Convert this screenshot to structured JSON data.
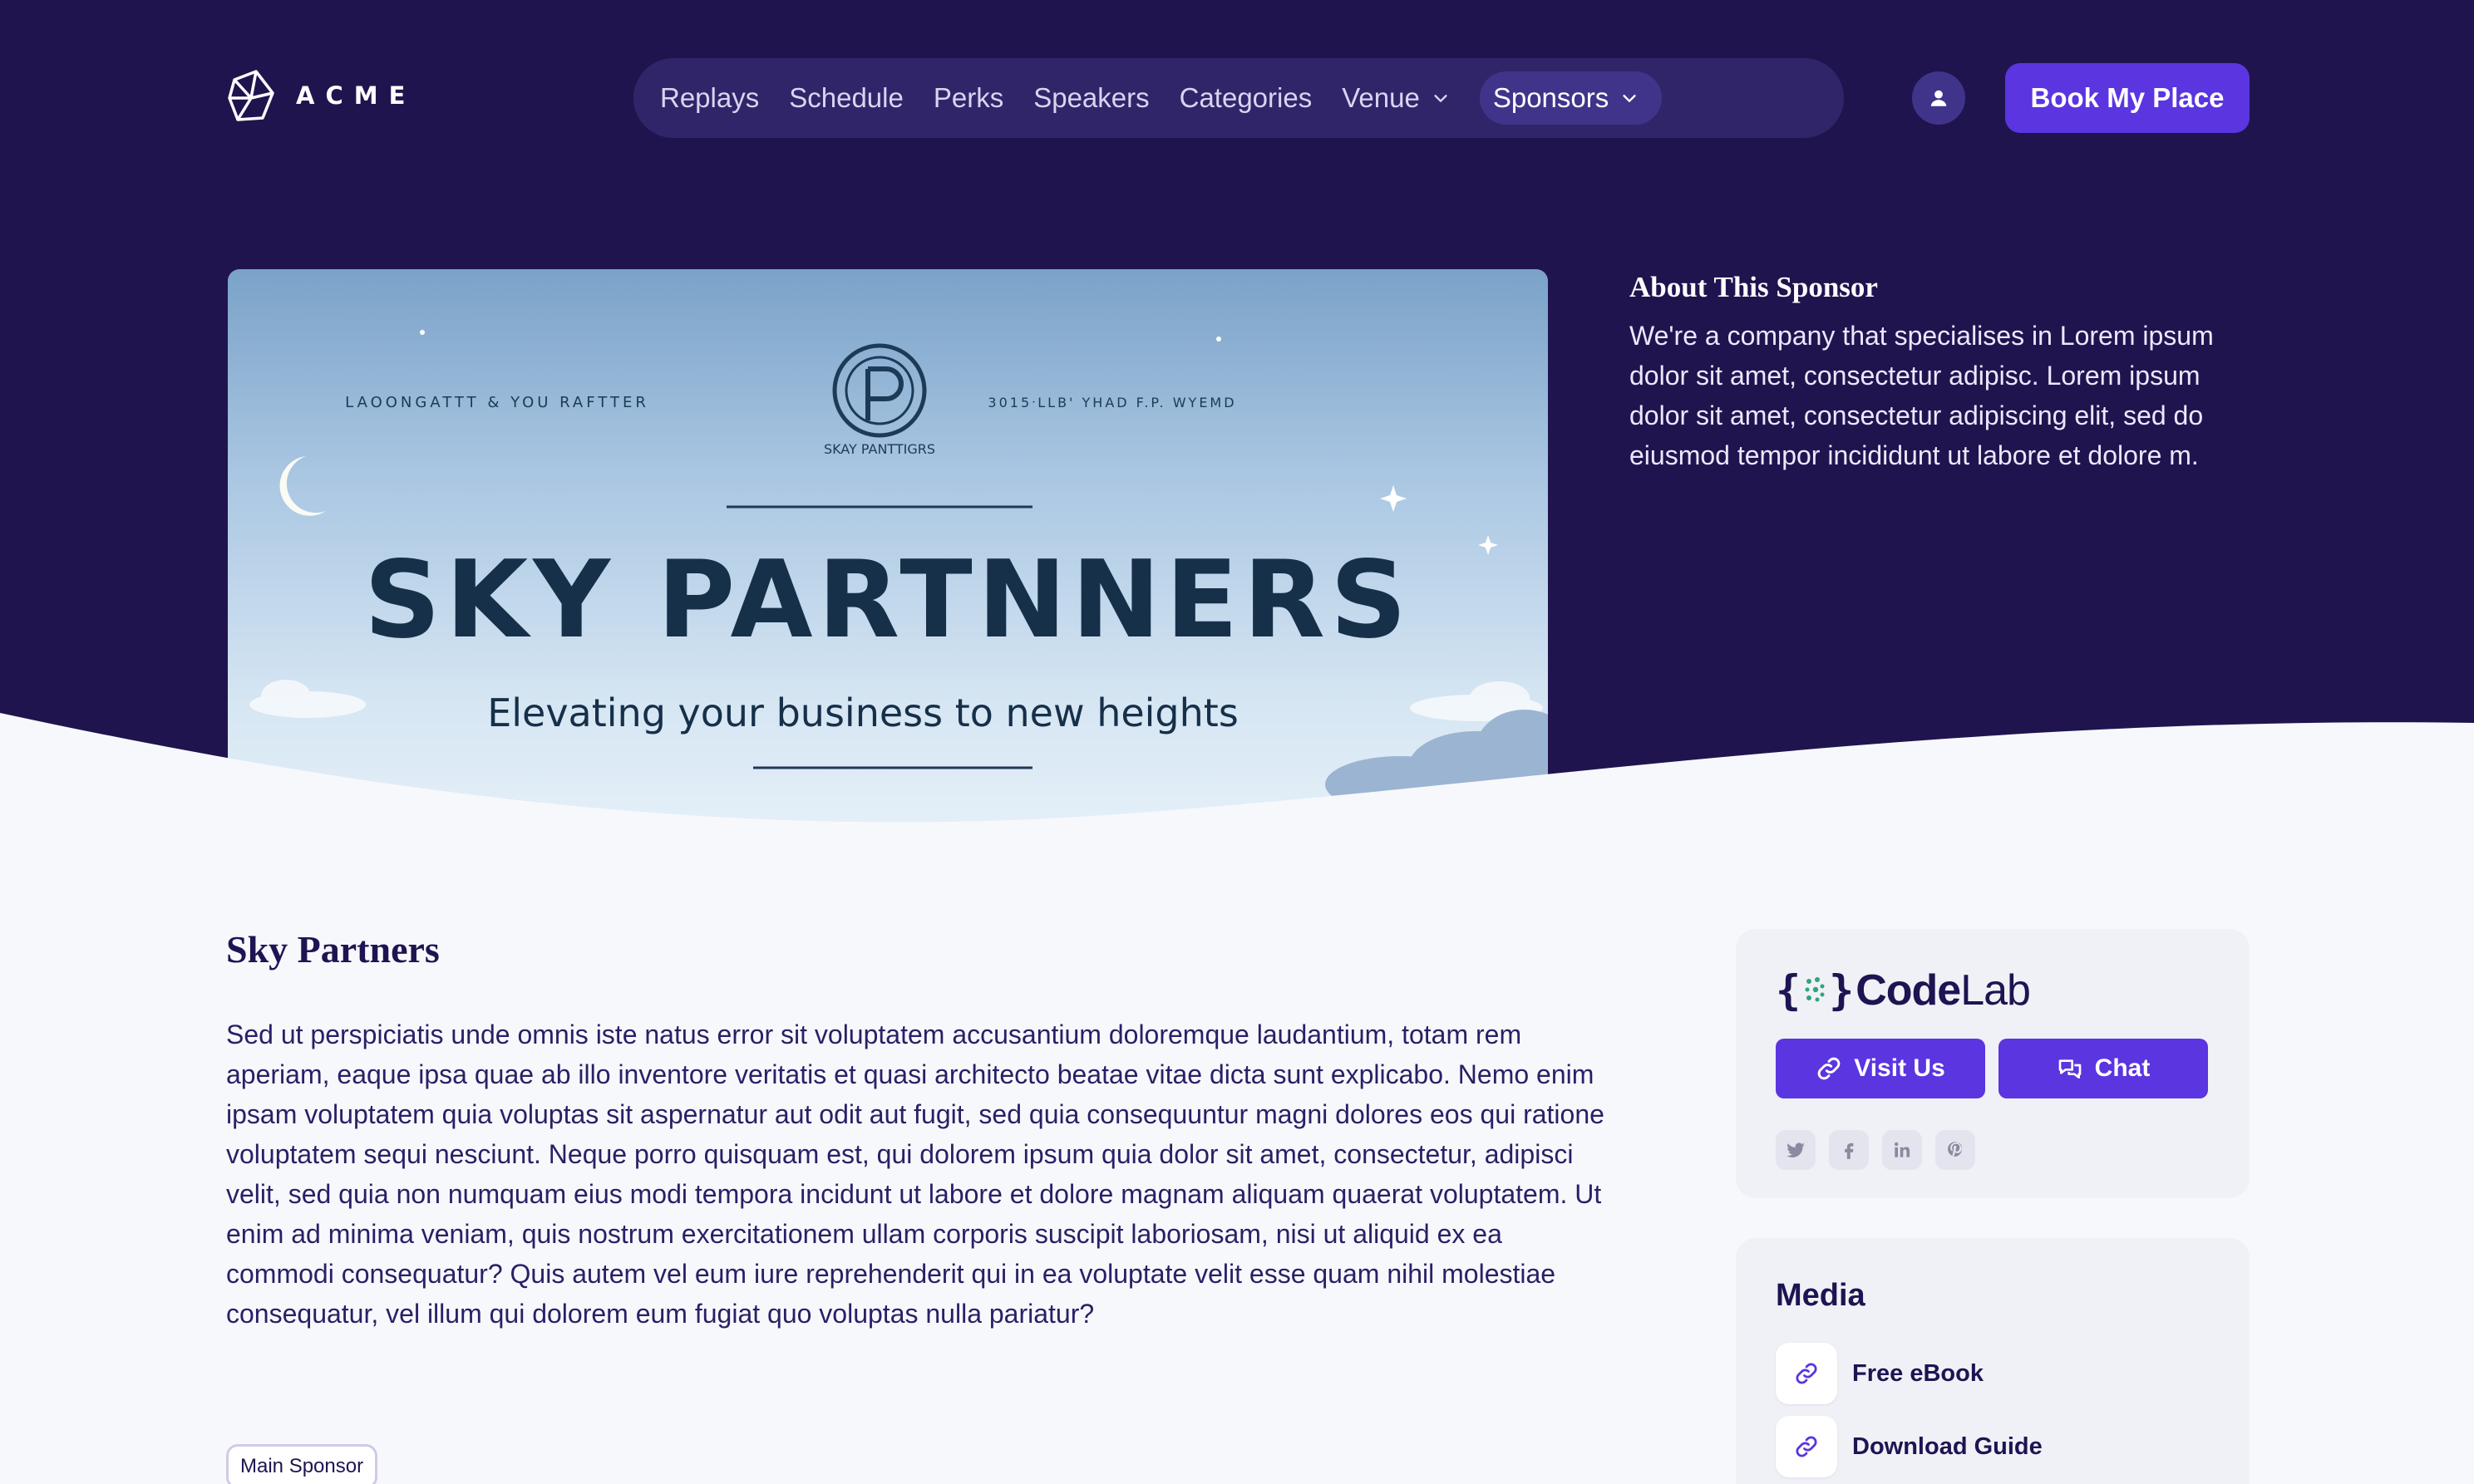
{
  "brand": {
    "name": "ACME"
  },
  "nav": {
    "items": [
      {
        "label": "Replays"
      },
      {
        "label": "Schedule"
      },
      {
        "label": "Perks"
      },
      {
        "label": "Speakers"
      },
      {
        "label": "Categories"
      },
      {
        "label": "Venue",
        "dropdown": true
      },
      {
        "label": "Sponsors",
        "dropdown": true,
        "active": true
      }
    ]
  },
  "header": {
    "user_icon": "user-icon",
    "book_label": "Book My Place"
  },
  "banner": {
    "tagline_left": "LAOONGATTT & YOU RAFTTER",
    "tagline_right": "3015ᐧLLB' YHAD F.P. WYEMD",
    "logo_caption": "SKAY PANTTIGRS",
    "headline": "SKY PARTNNERS",
    "subline": "Elevating your business to new heights"
  },
  "about": {
    "title": "About This Sponsor",
    "body": "We're a company that specialises in Lorem ipsum dolor sit amet, consectetur adipisc. Lorem ipsum dolor sit amet, consectetur adipiscing elit, sed do eiusmod tempor incididunt ut labore et dolore m."
  },
  "sponsor": {
    "name": "Sky Partners",
    "description": "Sed ut perspiciatis unde omnis iste natus error sit voluptatem accusantium doloremque laudantium, totam rem aperiam, eaque ipsa quae ab illo inventore veritatis et quasi architecto beatae vitae dicta sunt explicabo. Nemo enim ipsam voluptatem quia voluptas sit aspernatur aut odit aut fugit, sed quia consequuntur magni dolores eos qui ratione voluptatem sequi nesciunt. Neque porro quisquam est, qui dolorem ipsum quia dolor sit amet, consectetur, adipisci velit, sed quia non numquam eius modi tempora incidunt ut labore et dolore magnam aliquam quaerat voluptatem. Ut enim ad minima veniam, quis nostrum exercitationem ullam corporis suscipit laboriosam, nisi ut aliquid ex ea commodi consequatur? Quis autem vel eum iure reprehenderit qui in ea voluptate velit esse quam nihil molestiae consequatur, vel illum qui dolorem eum fugiat quo voluptas nulla pariatur?",
    "badge": "Main Sponsor"
  },
  "sponsor_card": {
    "logo_code": "Code",
    "logo_lab": "Lab",
    "visit_label": "Visit Us",
    "chat_label": "Chat",
    "socials": [
      "twitter-icon",
      "facebook-icon",
      "linkedin-icon",
      "pinterest-icon"
    ]
  },
  "media": {
    "title": "Media",
    "items": [
      {
        "label": "Free eBook",
        "icon": "link-icon"
      },
      {
        "label": "Download Guide",
        "icon": "link-icon"
      }
    ]
  },
  "colors": {
    "hero_bg": "#20144f",
    "nav_bg": "#31256a",
    "accent": "#5a35e0",
    "page_bg": "#f7f8fc",
    "text_dark": "#1e1452"
  }
}
